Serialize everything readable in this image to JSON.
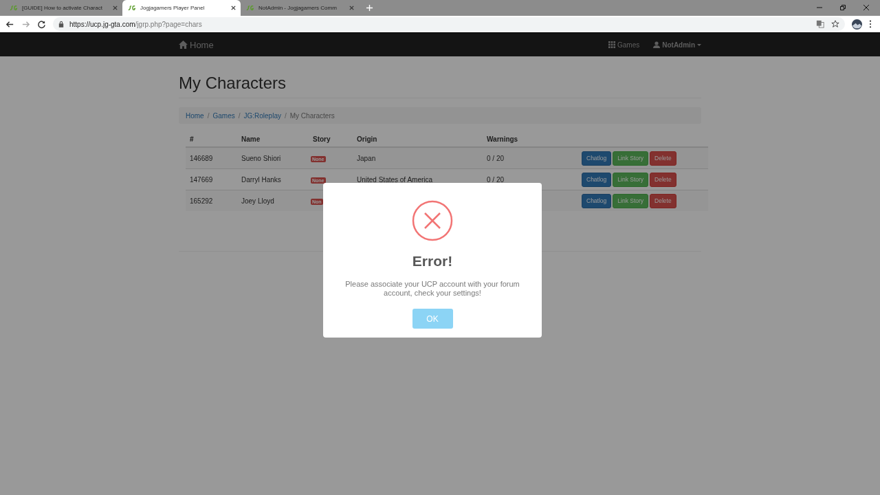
{
  "browser": {
    "tabs": [
      {
        "title": "[GUIDE] How to activate Charact",
        "selected": false
      },
      {
        "title": "Jogjagamers Player Panel",
        "selected": true
      },
      {
        "title": "NotAdmin - Jogjagamers Comm",
        "selected": false
      }
    ],
    "url_host": "https://ucp.jg-gta.com",
    "url_path": "/jgrp.php?page=chars"
  },
  "navbar": {
    "brand": "Home",
    "games": "Games",
    "user": "NotAdmin"
  },
  "page": {
    "title": "My Characters",
    "breadcrumb": [
      {
        "label": "Home",
        "link": true
      },
      {
        "separator": "/",
        "label": "Games",
        "link": true
      },
      {
        "separator": "/",
        "label": "JG:Roleplay",
        "link": true
      },
      {
        "separator": "/",
        "label": "My Characters",
        "link": false
      }
    ]
  },
  "table": {
    "columns": [
      "#",
      "Name",
      "Story",
      "Origin",
      "Warnings"
    ],
    "rows": [
      {
        "id": "146689",
        "name": "Sueno Shiori",
        "story": "None",
        "origin": "Japan",
        "warnings": "0 / 20",
        "actions": [
          {
            "label": "Chatlog",
            "kind": "primary"
          },
          {
            "label": "Link Story",
            "kind": "success"
          },
          {
            "label": "Delete",
            "kind": "danger"
          }
        ]
      },
      {
        "id": "147669",
        "name": "Darryl Hanks",
        "story": "None",
        "origin": "United States of America",
        "warnings": "0 / 20",
        "actions": [
          {
            "label": "Chatlog",
            "kind": "primary"
          },
          {
            "label": "Link Story",
            "kind": "success"
          },
          {
            "label": "Delete",
            "kind": "danger"
          }
        ]
      },
      {
        "id": "165292",
        "name": "Joey Lloyd",
        "story": "Non",
        "actions": [
          {
            "label": "Chatlog",
            "kind": "primary"
          },
          {
            "label": "Link Story",
            "kind": "success"
          },
          {
            "label": "Delete",
            "kind": "danger"
          }
        ]
      }
    ]
  },
  "dialog": {
    "title": "Error!",
    "message": "Please associate your UCP account with your forum account, check your settings!",
    "button": "OK"
  }
}
